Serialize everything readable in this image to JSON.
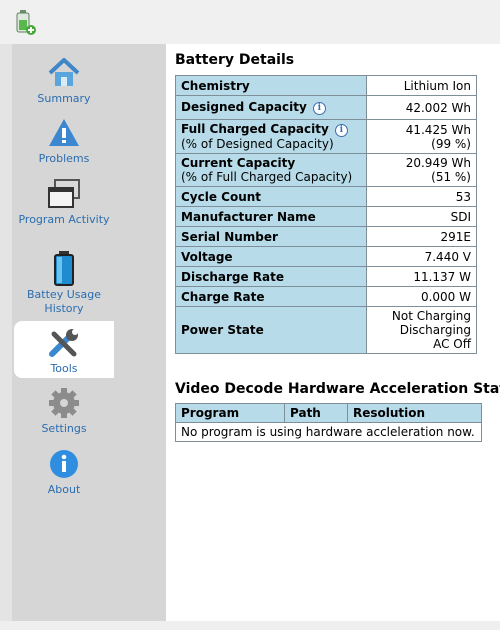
{
  "sidebar": {
    "items": [
      {
        "label": "Summary",
        "icon": "home-icon"
      },
      {
        "label": "Problems",
        "icon": "warning-icon"
      },
      {
        "label": "Program Activity",
        "icon": "windows-icon"
      },
      {
        "label": "Battey Usage History",
        "icon": "battery-icon"
      },
      {
        "label": "Tools",
        "icon": "tools-icon",
        "active": true
      },
      {
        "label": "Settings",
        "icon": "gear-icon"
      },
      {
        "label": "About",
        "icon": "info-icon"
      }
    ]
  },
  "battery": {
    "title": "Battery Details",
    "rows": [
      {
        "key": "Chemistry",
        "value": "Lithium Ion"
      },
      {
        "key": "Designed Capacity",
        "value": "42.002 Wh"
      },
      {
        "key": "Full Charged Capacity",
        "sub": "(% of Designed Capacity)",
        "value": "41.425 Wh",
        "value2": "(99 %)"
      },
      {
        "key": "Current Capacity",
        "sub": "(% of Full Charged Capacity)",
        "value": "20.949 Wh",
        "value2": "(51 %)"
      },
      {
        "key": "Cycle Count",
        "value": "53"
      },
      {
        "key": "Manufacturer Name",
        "value": "SDI"
      },
      {
        "key": "Serial Number",
        "value": "291E"
      },
      {
        "key": "Voltage",
        "value": "7.440 V"
      },
      {
        "key": "Discharge Rate",
        "value": "11.137 W"
      },
      {
        "key": "Charge Rate",
        "value": "0.000 W"
      },
      {
        "key": "Power State",
        "value": "Not Charging",
        "value2": "Discharging",
        "value3": "AC Off"
      }
    ]
  },
  "video": {
    "title": "Video Decode Hardware Acceleration Stat",
    "headers": [
      "Program",
      "Path",
      "Resolution"
    ],
    "empty_message": "No program is using hardware accleleration now."
  },
  "colors": {
    "accent": "#2a6db0",
    "header_cell": "#b7dbe8"
  }
}
